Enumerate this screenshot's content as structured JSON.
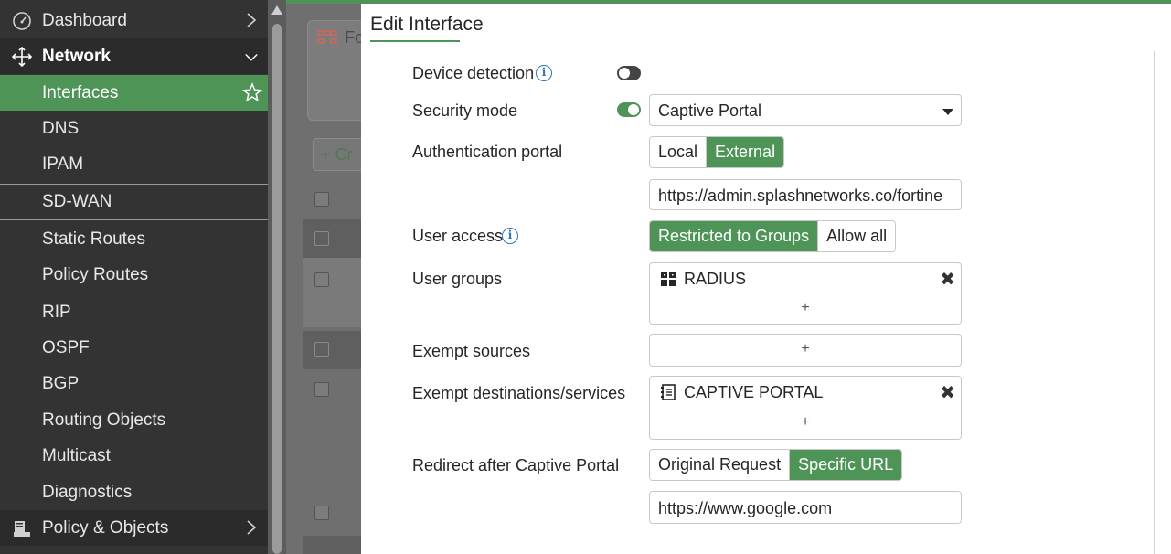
{
  "sidebar": {
    "items": [
      {
        "label": "Dashboard",
        "icon": "dashboard-gauge-icon"
      },
      {
        "label": "Network",
        "icon": "network-move-icon"
      },
      {
        "label": "Interfaces"
      },
      {
        "label": "DNS"
      },
      {
        "label": "IPAM"
      },
      {
        "label": "SD-WAN"
      },
      {
        "label": "Static Routes"
      },
      {
        "label": "Policy Routes"
      },
      {
        "label": "RIP"
      },
      {
        "label": "OSPF"
      },
      {
        "label": "BGP"
      },
      {
        "label": "Routing Objects"
      },
      {
        "label": "Multicast"
      },
      {
        "label": "Diagnostics"
      },
      {
        "label": "Policy & Objects",
        "icon": "policy-objects-icon"
      }
    ]
  },
  "background": {
    "card_label": "Fo",
    "create_label": "+ Cr"
  },
  "modal": {
    "title": "Edit Interface",
    "device_detection": {
      "label": "Device detection",
      "enabled": false
    },
    "security_mode": {
      "label": "Security mode",
      "enabled": true,
      "value": "Captive Portal"
    },
    "auth_portal": {
      "label": "Authentication portal",
      "options": [
        "Local",
        "External"
      ],
      "selected": "External",
      "url": "https://admin.splashnetworks.co/fortine"
    },
    "user_access": {
      "label": "User access",
      "options": [
        "Restricted to Groups",
        "Allow all"
      ],
      "selected": "Restricted to Groups"
    },
    "user_groups": {
      "label": "User groups",
      "tag": "RADIUS",
      "add": "+"
    },
    "exempt_sources": {
      "label": "Exempt sources",
      "add": "+"
    },
    "exempt_destinations": {
      "label": "Exempt destinations/services",
      "tag": "CAPTIVE PORTAL",
      "add": "+"
    },
    "redirect": {
      "label": "Redirect after Captive Portal",
      "options": [
        "Original Request",
        "Specific URL"
      ],
      "selected": "Specific URL",
      "url": "https://www.google.com"
    }
  },
  "colors": {
    "accent": "#4d9456",
    "sidebar_bg": "#333333",
    "info_blue": "#2d78b8"
  }
}
